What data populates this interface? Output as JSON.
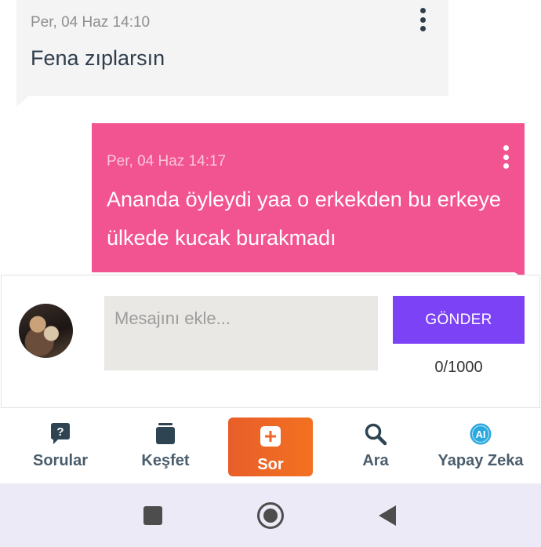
{
  "messages": [
    {
      "direction": "incoming",
      "time": "Per, 04 Haz 14:10",
      "text": "Fena zıplarsın",
      "bubble_color": "#f4f4f4"
    },
    {
      "direction": "outgoing",
      "time": "Per, 04 Haz 14:17",
      "text": "Ananda öyleydi yaa o erkekden bu erkeye ülkede kucak burakmadı",
      "bubble_color": "#f25391"
    }
  ],
  "composer": {
    "placeholder": "Mesajını ekle...",
    "value": "",
    "send_label": "GÖNDER",
    "send_color": "#7c43f6",
    "counter": "0/1000"
  },
  "bottom_nav": [
    {
      "label": "Sorular",
      "icon": "question-bubble-icon"
    },
    {
      "label": "Keşfet",
      "icon": "stack-cards-icon"
    },
    {
      "label": "Sor",
      "icon": "add-plus-icon",
      "active": true,
      "accent": "#f37120"
    },
    {
      "label": "Ara",
      "icon": "search-icon"
    },
    {
      "label": "Yapay Zeka",
      "icon": "ai-badge-icon",
      "accent": "#29a8e0"
    }
  ],
  "system_nav": [
    "recents-square-icon",
    "home-circle-icon",
    "back-triangle-icon"
  ]
}
